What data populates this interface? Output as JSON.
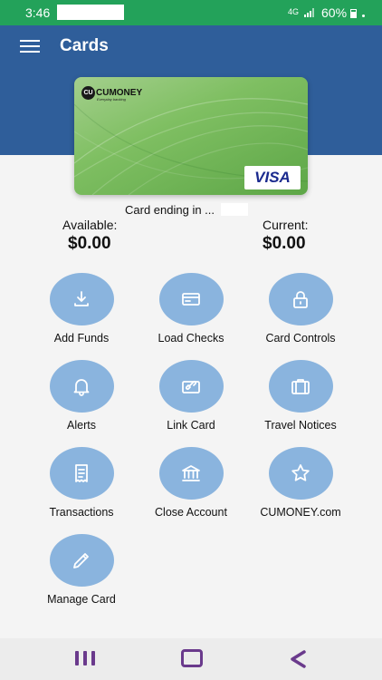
{
  "status_bar": {
    "time": "3:46",
    "network": "4G",
    "battery": "60%"
  },
  "header": {
    "title": "Cards"
  },
  "card": {
    "brand": "CUMONEY",
    "logo_letters": "CU",
    "tagline": "Everyday banking",
    "network": "VISA",
    "ending_text": "Card ending in ..."
  },
  "balances": {
    "available_label": "Available:",
    "available_value": "$0.00",
    "current_label": "Current:",
    "current_value": "$0.00"
  },
  "actions": [
    {
      "label": "Add Funds",
      "icon": "download-icon"
    },
    {
      "label": "Load Checks",
      "icon": "card-icon"
    },
    {
      "label": "Card Controls",
      "icon": "lock-icon"
    },
    {
      "label": "Alerts",
      "icon": "bell-icon"
    },
    {
      "label": "Link Card",
      "icon": "link-card-icon"
    },
    {
      "label": "Travel Notices",
      "icon": "suitcase-icon"
    },
    {
      "label": "Transactions",
      "icon": "receipt-icon"
    },
    {
      "label": "Close Account",
      "icon": "bank-icon"
    },
    {
      "label": "CUMONEY.com",
      "icon": "star-icon"
    },
    {
      "label": "Manage Card",
      "icon": "pencil-icon"
    }
  ],
  "nav": {
    "recent": "recent-apps-icon",
    "home": "home-icon",
    "back": "back-icon"
  },
  "colors": {
    "status_bar": "#23a25a",
    "header": "#2f5e9a",
    "action_circle": "#8ab4de",
    "nav_icon": "#6a3a8c"
  }
}
